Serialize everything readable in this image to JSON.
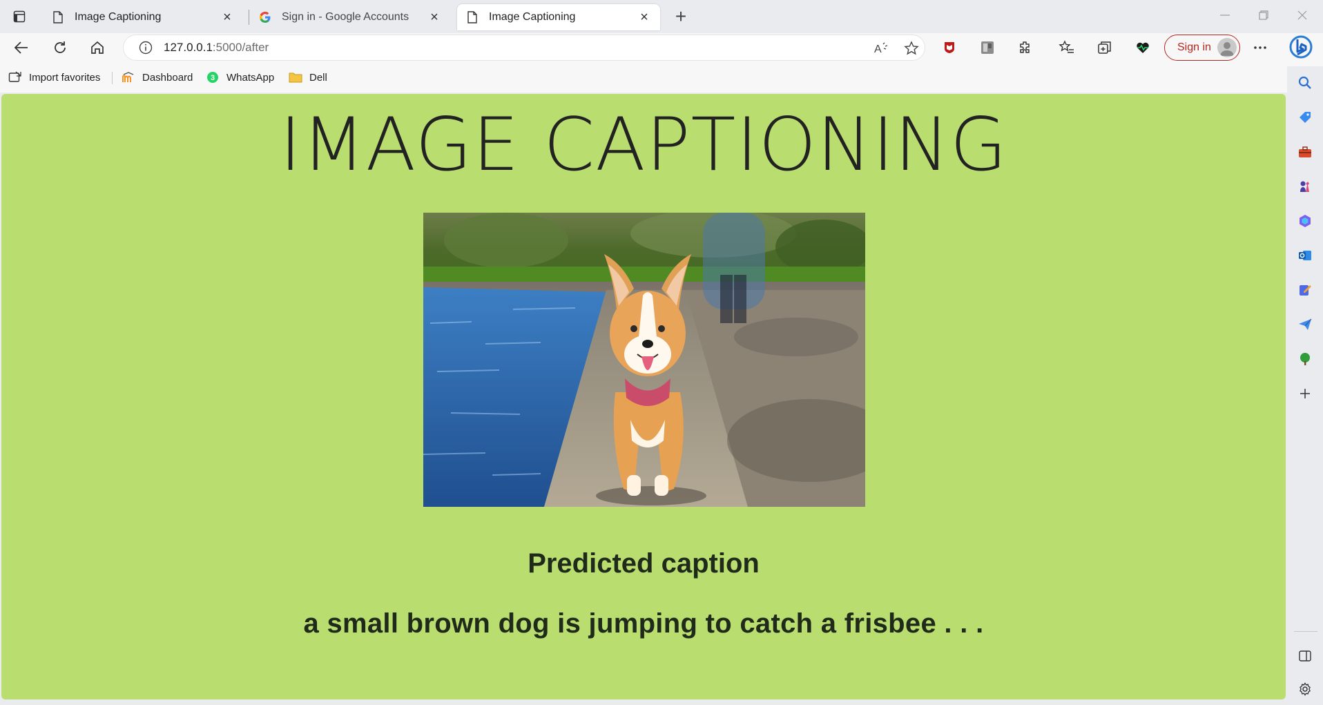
{
  "browser": {
    "tabs": [
      {
        "title": "Image Captioning",
        "icon": "page-icon",
        "active": false
      },
      {
        "title": "Sign in - Google Accounts",
        "icon": "google-icon",
        "active": false
      },
      {
        "title": "Image Captioning",
        "icon": "page-icon",
        "active": true
      }
    ],
    "address": {
      "host": "127.0.0.1",
      "path": ":5000/after"
    },
    "signin_label": "Sign in",
    "favorites": [
      {
        "label": "Import favorites",
        "icon": "import-icon"
      },
      {
        "label": "Dashboard",
        "icon": "moodle-icon"
      },
      {
        "label": "WhatsApp",
        "icon": "whatsapp-icon"
      },
      {
        "label": "Dell",
        "icon": "folder-icon"
      }
    ],
    "whatsapp_badge": "3"
  },
  "page": {
    "title": "IMAGE CAPTIONING",
    "image_alt_icon": "corgi-photo",
    "caption_heading": "Predicted caption",
    "caption_text": "a small brown dog is jumping to catch a frisbee . . ."
  },
  "colors": {
    "page_background": "#b9de6f",
    "signin_accent": "#b3261e"
  }
}
